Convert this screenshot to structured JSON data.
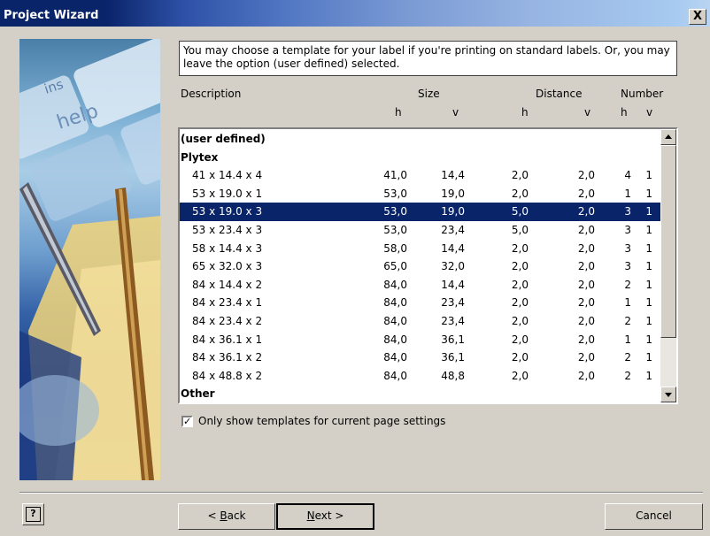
{
  "window": {
    "title": "Project Wizard",
    "close_label": "X"
  },
  "side_image": {
    "key_labels": [
      "ins",
      "help"
    ]
  },
  "info_text": "You may choose a template for your label if you're printing on standard labels. Or, you may leave the option (user defined) selected.",
  "columns": {
    "description": "Description",
    "size": "Size",
    "distance": "Distance",
    "number": "Number",
    "size_h": "h",
    "size_v": "v",
    "distance_h": "h",
    "distance_v": "v",
    "number_h": "h",
    "number_v": "v"
  },
  "templates": [
    {
      "desc": "(user defined)",
      "group": true
    },
    {
      "desc": "Plytex",
      "group": true
    },
    {
      "desc": "41 x 14.4 x 4",
      "sh": "41,0",
      "sv": "14,4",
      "dh": "2,0",
      "dv": "2,0",
      "nh": "4",
      "nv": "1"
    },
    {
      "desc": "53 x 19.0 x 1",
      "sh": "53,0",
      "sv": "19,0",
      "dh": "2,0",
      "dv": "2,0",
      "nh": "1",
      "nv": "1"
    },
    {
      "desc": "53 x 19.0 x 3",
      "sh": "53,0",
      "sv": "19,0",
      "dh": "5,0",
      "dv": "2,0",
      "nh": "3",
      "nv": "1",
      "selected": true
    },
    {
      "desc": "53 x 23.4 x 3",
      "sh": "53,0",
      "sv": "23,4",
      "dh": "5,0",
      "dv": "2,0",
      "nh": "3",
      "nv": "1"
    },
    {
      "desc": "58 x 14.4 x 3",
      "sh": "58,0",
      "sv": "14,4",
      "dh": "2,0",
      "dv": "2,0",
      "nh": "3",
      "nv": "1"
    },
    {
      "desc": "65 x 32.0 x 3",
      "sh": "65,0",
      "sv": "32,0",
      "dh": "2,0",
      "dv": "2,0",
      "nh": "3",
      "nv": "1"
    },
    {
      "desc": "84 x 14.4 x 2",
      "sh": "84,0",
      "sv": "14,4",
      "dh": "2,0",
      "dv": "2,0",
      "nh": "2",
      "nv": "1"
    },
    {
      "desc": "84 x 23.4 x 1",
      "sh": "84,0",
      "sv": "23,4",
      "dh": "2,0",
      "dv": "2,0",
      "nh": "1",
      "nv": "1"
    },
    {
      "desc": "84 x 23.4 x 2",
      "sh": "84,0",
      "sv": "23,4",
      "dh": "2,0",
      "dv": "2,0",
      "nh": "2",
      "nv": "1"
    },
    {
      "desc": "84 x 36.1 x 1",
      "sh": "84,0",
      "sv": "36,1",
      "dh": "2,0",
      "dv": "2,0",
      "nh": "1",
      "nv": "1"
    },
    {
      "desc": "84 x 36.1 x 2",
      "sh": "84,0",
      "sv": "36,1",
      "dh": "2,0",
      "dv": "2,0",
      "nh": "2",
      "nv": "1"
    },
    {
      "desc": "84 x 48.8 x 2",
      "sh": "84,0",
      "sv": "48,8",
      "dh": "2,0",
      "dv": "2,0",
      "nh": "2",
      "nv": "1"
    },
    {
      "desc": "Other",
      "group": true
    }
  ],
  "checkbox": {
    "checked": true,
    "check_glyph": "✓",
    "label": "Only show templates for current page settings"
  },
  "buttons": {
    "help": "?",
    "back_mnemonic": "B",
    "back_rest": "ack",
    "back_prefix": "< ",
    "next_mnemonic": "N",
    "next_rest": "ext >",
    "cancel": "Cancel"
  },
  "colors": {
    "selection": "#0a246a",
    "title_start": "#0a246a",
    "dialog_bg": "#d4d0c8"
  }
}
